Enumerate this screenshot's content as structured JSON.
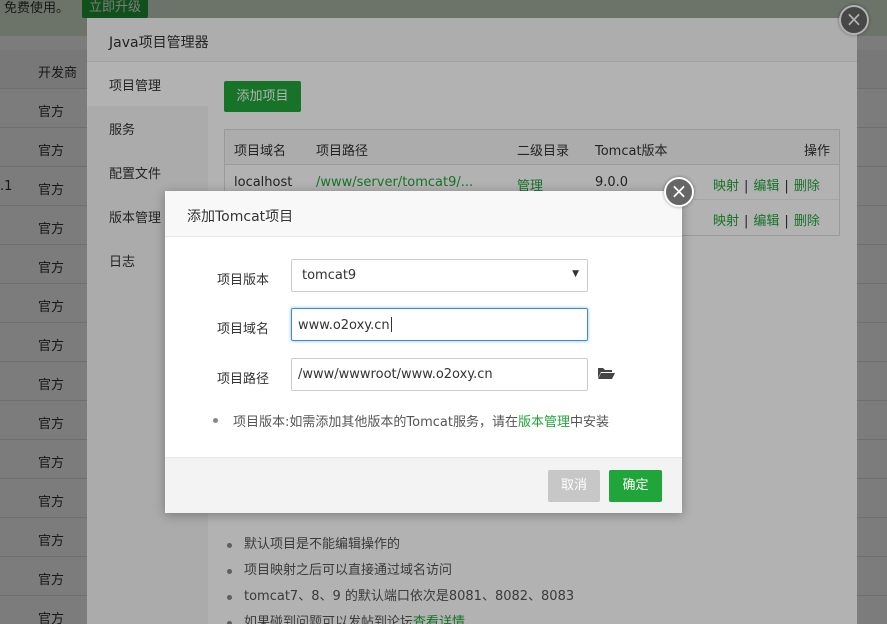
{
  "topbar": {
    "notice": "免费使用。",
    "upgrade_label": "立即升级"
  },
  "bg_table": {
    "header": "开发商",
    "version_text": ".1",
    "vendor_cell": "官方"
  },
  "java_window": {
    "title": "Java项目管理器",
    "close_icon": "×",
    "sidebar": [
      {
        "label": "项目管理"
      },
      {
        "label": "服务"
      },
      {
        "label": "配置文件"
      },
      {
        "label": "版本管理"
      },
      {
        "label": "日志"
      }
    ],
    "add_button": "添加项目",
    "table": {
      "headers": {
        "domain": "项目域名",
        "path": "项目路径",
        "subdir": "二级目录",
        "tomcat": "Tomcat版本",
        "ops": "操作"
      },
      "rows": [
        {
          "domain": "localhost",
          "path": "/www/server/tomcat9/...",
          "subdir": "管理",
          "tomcat": "9.0.0"
        },
        {
          "domain": "",
          "path": "",
          "subdir": "",
          "tomcat": ""
        }
      ],
      "op_map": "映射",
      "op_edit": "编辑",
      "op_delete": "删除",
      "sep": "|"
    },
    "notes": [
      "默认项目是不能编辑操作的",
      "项目映射之后可以直接通过域名访问",
      "tomcat7、8、9 的默认端口依次是8081、8082、8083",
      "如果碰到问题可以发帖到论坛"
    ],
    "notes_link": "查看详情"
  },
  "dialog": {
    "title": "添加Tomcat项目",
    "close_icon": "×",
    "version_label": "项目版本",
    "version_value": "tomcat9",
    "domain_label": "项目域名",
    "domain_value": "www.o2oxy.cn",
    "path_label": "项目路径",
    "path_value": "/www/wwwroot/www.o2oxy.cn",
    "tip_prefix": "项目版本:如需添加其他版本的Tomcat服务，请在",
    "tip_link": "版本管理",
    "tip_suffix": "中安装",
    "cancel_label": "取消",
    "confirm_label": "确定",
    "icons": {
      "folder": "folder-open-icon",
      "select_arrow": "caret-down-icon"
    }
  },
  "colors": {
    "brand_green": "#20a53a",
    "focus_blue": "#3b8beb"
  }
}
